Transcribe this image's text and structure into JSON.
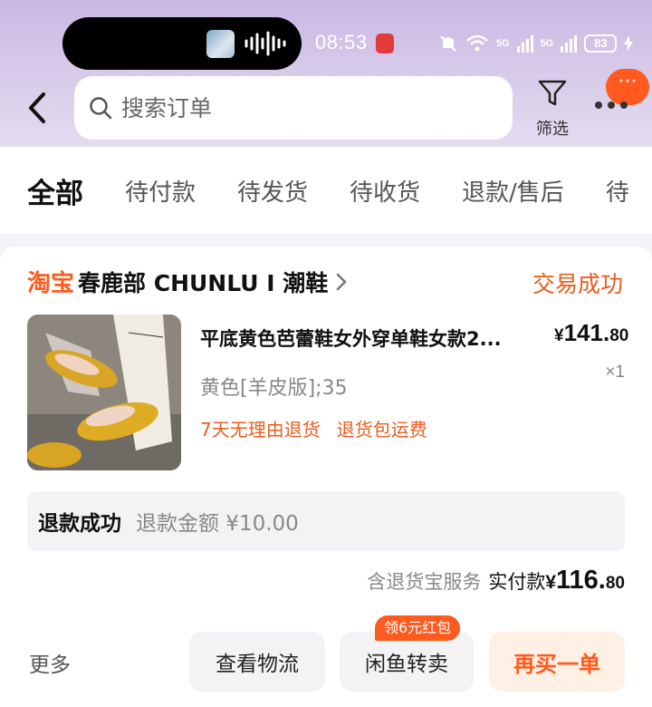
{
  "status_bar": {
    "time": "08:53",
    "network_1": "5G",
    "network_2": "5G",
    "battery": "83"
  },
  "search": {
    "placeholder": "搜索订单"
  },
  "header": {
    "filter_label": "筛选",
    "more_label": "···"
  },
  "tabs": [
    {
      "label": "全部",
      "active": true
    },
    {
      "label": "待付款"
    },
    {
      "label": "待发货"
    },
    {
      "label": "待收货"
    },
    {
      "label": "退款/售后"
    },
    {
      "label": "待"
    }
  ],
  "order": {
    "platform_tag": "淘宝",
    "shop_name": "春鹿部 CHUNLU I 潮鞋",
    "status": "交易成功",
    "product": {
      "title": "平底黄色芭蕾鞋女外穿单鞋女款2...",
      "price_yen": "¥",
      "price_int": "141.",
      "price_dec": "80",
      "quantity": "×1",
      "variant": "黄色[羊皮版];35",
      "services": [
        "7天无理由退货",
        "退货包运费"
      ]
    },
    "refund": {
      "status": "退款成功",
      "amount_text": "退款金额 ¥10.00"
    },
    "payment": {
      "note": "含退货宝服务",
      "label": "实付款",
      "yen": "¥",
      "int": "116.",
      "dec": "80"
    },
    "actions": {
      "more": "更多",
      "logistics": "查看物流",
      "resell": "闲鱼转卖",
      "resell_badge": "领6元红包",
      "rebuy": "再买一单"
    }
  },
  "colors": {
    "accent": "#ff5a1f",
    "status_orange": "#e85d1e",
    "header_gradient_top": "#cbb7e3"
  }
}
